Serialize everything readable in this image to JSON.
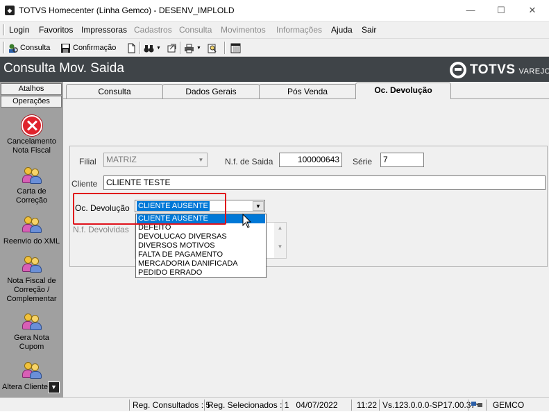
{
  "window": {
    "title": "TOTVS Homecenter (Linha Gemco) - DESENV_IMPLOLD",
    "controls": {
      "minimize": "—",
      "maximize": "☐",
      "close": "✕"
    }
  },
  "menu": [
    {
      "label": "Login",
      "enabled": true
    },
    {
      "label": "Favoritos",
      "enabled": true
    },
    {
      "label": "Impressoras",
      "enabled": true
    },
    {
      "label": "Cadastros",
      "enabled": false
    },
    {
      "label": "Consulta",
      "enabled": false
    },
    {
      "label": "Movimentos",
      "enabled": false
    },
    {
      "label": "Informações",
      "enabled": false
    },
    {
      "label": "Ajuda",
      "enabled": true
    },
    {
      "label": "Sair",
      "enabled": true
    }
  ],
  "toolbar": {
    "consulta_label": "Consulta",
    "confirmacao_label": "Confirmação"
  },
  "header": {
    "page_title": "Consulta Mov. Saida",
    "brand": "TOTVS",
    "brand_sub": "VAREJO"
  },
  "sidebar": {
    "atalhos": "Atalhos",
    "operacoes": "Operações",
    "items": [
      {
        "label": "Cancelamento Nota Fiscal",
        "icon": "cancel-icon"
      },
      {
        "label": "Carta de Correção",
        "icon": "people-icon"
      },
      {
        "label": "Reenvio do XML",
        "icon": "people-icon"
      },
      {
        "label": "Nota Fiscal de Correção / Complementar",
        "icon": "people-icon"
      },
      {
        "label": "Gera Nota Cupom",
        "icon": "people-icon"
      },
      {
        "label": "Altera Cliente",
        "icon": "people-icon"
      }
    ]
  },
  "tabs": [
    {
      "label": "Consulta",
      "active": false
    },
    {
      "label": "Dados Gerais",
      "active": false
    },
    {
      "label": "Pós Venda",
      "active": false
    },
    {
      "label": "Oc. Devolução",
      "active": true
    }
  ],
  "form": {
    "filial_label": "Filial",
    "filial_value": "MATRIZ",
    "nf_saida_label": "N.f. de Saida",
    "nf_saida_value": "100000643",
    "serie_label": "Série",
    "serie_value": "7",
    "cliente_label": "Cliente",
    "cliente_value": "CLIENTE TESTE",
    "oc_devolucao_label": "Oc. Devolução",
    "oc_devolucao_value": "CLIENTE AUSENTE",
    "nf_devolvidas_label": "N.f. Devolvidas"
  },
  "dropdown_options": [
    "CLIENTE AUSENTE",
    "DEFEITO",
    "DEVOLUCAO DIVERSAS",
    "DIVERSOS MOTIVOS",
    "FALTA DE PAGAMENTO",
    "MERCADORIA DANIFICADA",
    "PEDIDO ERRADO"
  ],
  "dropdown_selected_index": 0,
  "status": {
    "reg_consultados": "Reg. Consultados : 5",
    "reg_selecionados": "Reg. Selecionados : 1",
    "date": "04/07/2022",
    "time": "11:22",
    "version": "Vs.123.0.0.0-SP17.00.37",
    "company": "GEMCO"
  },
  "colors": {
    "header_bg": "#3f4448",
    "selection": "#0078d7",
    "highlight_box": "#e0121b",
    "sidebar_bg": "#a0a0a0"
  }
}
